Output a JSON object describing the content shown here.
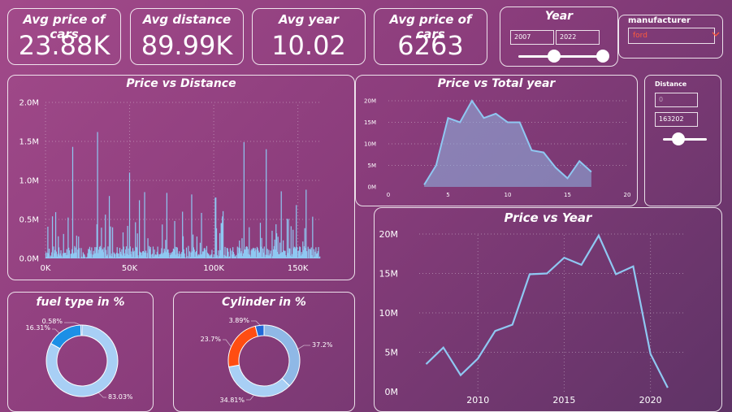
{
  "kpis": [
    {
      "title": "Avg price of cars",
      "value": "23.88K"
    },
    {
      "title": "Avg distance",
      "value": "89.99K"
    },
    {
      "title": "Avg year",
      "value": "10.02"
    },
    {
      "title": "Avg price of cars",
      "value": "6263"
    }
  ],
  "year_slicer": {
    "title": "Year",
    "start": "2007",
    "end": "2022",
    "start_fraction": 0.42,
    "end_fraction": 1.0
  },
  "manufacturer_slicer": {
    "title": "manufacturer",
    "selected": "ford",
    "chevron_icon": "chevron-down-icon"
  },
  "distance_slicer": {
    "title": "Distance",
    "min_placeholder": "0",
    "max": "163202",
    "position_fraction": 0.35
  },
  "colors": {
    "line": "#8fc8f2",
    "area": "#8fb8e6",
    "donut_light": "#a8cff5",
    "donut_blue": "#1c8fe6",
    "donut_orange": "#ff4d12",
    "donut_dark_blue": "#2167d8"
  },
  "chart_data": [
    {
      "type": "bar",
      "title": "Price vs Distance",
      "xlim": [
        0,
        163202
      ],
      "ylim": [
        0,
        2000000
      ],
      "x_ticks": [
        {
          "v": 0,
          "label": "0K"
        },
        {
          "v": 50000,
          "label": "50K"
        },
        {
          "v": 100000,
          "label": "100K"
        },
        {
          "v": 150000,
          "label": "150K"
        }
      ],
      "y_ticks": [
        {
          "v": 0,
          "label": "0.0M"
        },
        {
          "v": 500000,
          "label": "0.5M"
        },
        {
          "v": 1000000,
          "label": "1.0M"
        },
        {
          "v": 1500000,
          "label": "1.5M"
        },
        {
          "v": 2000000,
          "label": "2.0M"
        }
      ],
      "peaks": [
        [
          16000,
          1430000
        ],
        [
          31000,
          1620000
        ],
        [
          38000,
          800000
        ],
        [
          50000,
          1100000
        ],
        [
          59000,
          850000
        ],
        [
          72000,
          840000
        ],
        [
          87000,
          820000
        ],
        [
          101000,
          780000
        ],
        [
          118000,
          1490000
        ],
        [
          131000,
          1400000
        ],
        [
          140000,
          860000
        ]
      ]
    },
    {
      "type": "area",
      "title": "Price vs Total year",
      "x": [
        3,
        4,
        5,
        6,
        7,
        8,
        9,
        10,
        11,
        12,
        13,
        14,
        15,
        16,
        17
      ],
      "y": [
        0.5,
        5,
        16,
        15,
        20,
        16,
        17,
        15,
        15,
        8.5,
        8,
        4.5,
        2,
        6,
        3.5
      ],
      "xlim": [
        0,
        20
      ],
      "ylim": [
        0,
        20
      ],
      "x_ticks": [
        {
          "v": 0,
          "label": "0"
        },
        {
          "v": 5,
          "label": "5"
        },
        {
          "v": 10,
          "label": "10"
        },
        {
          "v": 15,
          "label": "15"
        },
        {
          "v": 20,
          "label": "20"
        }
      ],
      "y_ticks": [
        {
          "v": 0,
          "label": "0M"
        },
        {
          "v": 5,
          "label": "5M"
        },
        {
          "v": 10,
          "label": "10M"
        },
        {
          "v": 15,
          "label": "15M"
        },
        {
          "v": 20,
          "label": "20M"
        }
      ],
      "y_unit": "M"
    },
    {
      "type": "line",
      "title": "Price vs Year",
      "x": [
        2007,
        2008,
        2009,
        2010,
        2011,
        2012,
        2013,
        2014,
        2015,
        2016,
        2017,
        2018,
        2019,
        2020,
        2021
      ],
      "y": [
        3.5,
        5.6,
        2.1,
        4.2,
        7.7,
        8.5,
        14.9,
        15.0,
        17.0,
        16.1,
        19.8,
        14.9,
        15.9,
        4.8,
        0.5
      ],
      "xlim": [
        2006.6,
        2021.9
      ],
      "ylim": [
        0,
        20
      ],
      "x_ticks": [
        {
          "v": 2010,
          "label": "2010"
        },
        {
          "v": 2015,
          "label": "2015"
        },
        {
          "v": 2020,
          "label": "2020"
        }
      ],
      "y_ticks": [
        {
          "v": 0,
          "label": "0M"
        },
        {
          "v": 5,
          "label": "5M"
        },
        {
          "v": 10,
          "label": "10M"
        },
        {
          "v": 15,
          "label": "15M"
        },
        {
          "v": 20,
          "label": "20M"
        }
      ],
      "y_unit": "M"
    },
    {
      "type": "pie",
      "title": "fuel type in %",
      "slices": [
        {
          "label": "83.03%",
          "value": 83.03,
          "color": "#a8cff5"
        },
        {
          "label": "16.31%",
          "value": 16.31,
          "color": "#1c8fe6"
        },
        {
          "label": "0.58%",
          "value": 0.58,
          "color": "#2167d8"
        }
      ]
    },
    {
      "type": "pie",
      "title": "Cylinder in %",
      "slices": [
        {
          "label": "37.2%",
          "value": 37.2,
          "color": "#8fb8e6"
        },
        {
          "label": "34.81%",
          "value": 34.81,
          "color": "#a8cff5"
        },
        {
          "label": "23.7%",
          "value": 23.7,
          "color": "#ff4d12"
        },
        {
          "label": "3.89%",
          "value": 3.89,
          "color": "#2167d8"
        }
      ]
    }
  ]
}
